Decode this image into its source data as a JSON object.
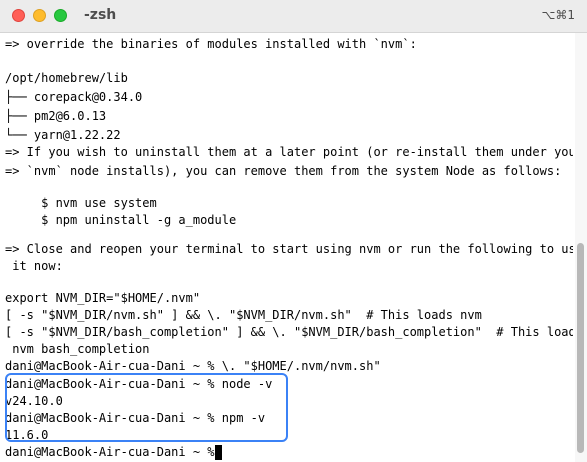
{
  "window": {
    "title": "-zsh",
    "shortcut": "⌥⌘1"
  },
  "terminal": {
    "lines": [
      "=> override the binaries of modules installed with `nvm`:",
      "",
      "/opt/homebrew/lib",
      "├── corepack@0.34.0",
      "├── pm2@6.0.13",
      "└── yarn@1.22.22",
      "=> If you wish to uninstall them at a later point (or re-install them under your",
      "=> `nvm` node installs), you can remove them from the system Node as follows:",
      "",
      "     $ nvm use system",
      "     $ npm uninstall -g a_module",
      "",
      "=> Close and reopen your terminal to start using nvm or run the following to use",
      " it now:",
      "",
      "export NVM_DIR=\"$HOME/.nvm\"",
      "[ -s \"$NVM_DIR/nvm.sh\" ] && \\. \"$NVM_DIR/nvm.sh\"  # This loads nvm",
      "[ -s \"$NVM_DIR/bash_completion\" ] && \\. \"$NVM_DIR/bash_completion\"  # This loads",
      " nvm bash_completion",
      "dani@MacBook-Air-cua-Dani ~ % \\. \"$HOME/.nvm/nvm.sh\"",
      "dani@MacBook-Air-cua-Dani ~ % node -v",
      "v24.10.0",
      "dani@MacBook-Air-cua-Dani ~ % npm -v",
      "11.6.0",
      "dani@MacBook-Air-cua-Dani ~ % "
    ]
  },
  "colors": {
    "highlight": "#3b82f6",
    "close": "#ff5f57",
    "minimize": "#febc2e",
    "maximize": "#28c840"
  }
}
